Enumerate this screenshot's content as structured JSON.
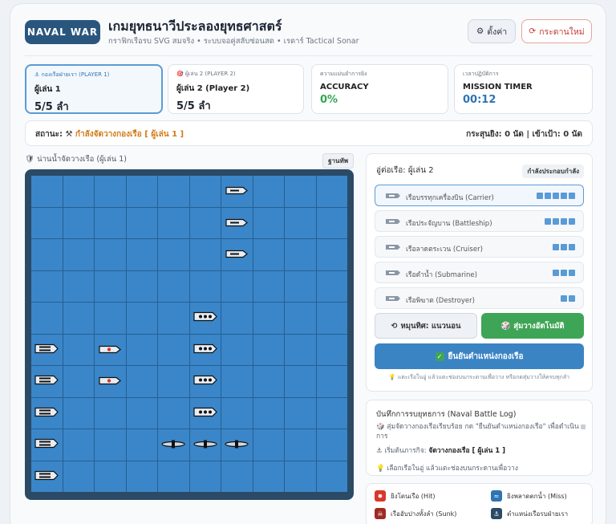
{
  "header": {
    "logo": "NAVAL WAR",
    "title": "เกมยุทธนาวีประลองยุทธศาสตร์",
    "subtitle": "กราฟิกเรือรบ SVG สมจริง • ระบบจอคู่สลับซ่อนสด • เรดาร์ Tactical Sonar",
    "settings_label": "ตั้งค่า",
    "newgame_label": "กระดานใหม่"
  },
  "stats": [
    {
      "label": "⚓ กองเรือฝ่ายเรา (PLAYER 1)",
      "name": "ผู้เล่น 1",
      "value": "5/5 ลำ"
    },
    {
      "label": "🎯 ผู้เล่น 2 (PLAYER 2)",
      "name": "ผู้เล่น 2 (Player 2)",
      "value": "5/5 ลำ"
    },
    {
      "label": "ความแม่นยำการยิง",
      "name": "ACCURACY",
      "value": "0%"
    },
    {
      "label": "เวลาปฏิบัติการ",
      "name": "MISSION TIMER",
      "value": "00:12"
    }
  ],
  "status": {
    "label": "สถานะ:",
    "icon": "⚒",
    "phase": "กำลังจัดวางกองเรือ [ ผู้เล่น 1 ]",
    "shots": "กระสุนยิง: 0 นัด | เข้าเป้า: 0 นัด"
  },
  "board": {
    "title": "🛡 น่านน้ำจัดวางเรือ (ผู้เล่น 1)",
    "badge": "ฐานทัพ"
  },
  "panel": {
    "title": "อู่ต่อเรือ: ผู้เล่น 2",
    "badge": "กำลังประกอบกำลัง",
    "ships": [
      {
        "name": "เรือบรรทุกเครื่องบิน (Carrier)",
        "size": 5,
        "icon": "carrier-icon"
      },
      {
        "name": "เรือประจัญบาน (Battleship)",
        "size": 4,
        "icon": "battleship-icon"
      },
      {
        "name": "เรือลาดตระเวน (Cruiser)",
        "size": 3,
        "icon": "cruiser-icon"
      },
      {
        "name": "เรือดำน้ำ (Submarine)",
        "size": 3,
        "icon": "submarine-icon"
      },
      {
        "name": "เรือพิฆาต (Destroyer)",
        "size": 2,
        "icon": "destroyer-icon"
      }
    ],
    "rotate_label": "หมุนทิศ: แนวนอน",
    "random_label": "สุ่มวางอัตโนมัติ",
    "confirm_label": "ยืนยันตำแหน่งกองเรือ",
    "hint": "💡 แตะเรือในอู่ แล้วแตะช่องบนกระดานเพื่อวาง หรือกดสุ่มวางให้ครบทุกลำ"
  },
  "log": {
    "title": "บันทึกการรบยุทธการ (Naval Battle Log)",
    "entries": [
      {
        "prefix": "🎲 สุ่มจัดวางกองเรือเรียบร้อย กด \"ยืนยันตำแหน่งกองเรือ\" เพื่อดำเนินการ",
        "bold": ""
      },
      {
        "prefix": "⚓ เริ่มต้นภารกิจ: ",
        "bold": "จัดวางกองเรือ [ ผู้เล่น 1 ]"
      },
      {
        "prefix": "💡 เลือกเรือในอู่ แล้วแตะช่องบนกระดานเพื่อวาง",
        "bold": ""
      }
    ]
  },
  "legend": {
    "hit": "ยิงโดนเรือ (Hit)",
    "miss": "ยิงพลาดตกน้ำ (Miss)",
    "sunk": "เรืออับปางทั้งลำ (Sunk)",
    "ally": "ตำแหน่งเรือรบฝ่ายเรา"
  },
  "colors": {
    "accent": "#2e74b5",
    "success": "#3fa556",
    "phase": "#d17a16",
    "danger": "#c23a31",
    "sea": "#3a86c8"
  }
}
